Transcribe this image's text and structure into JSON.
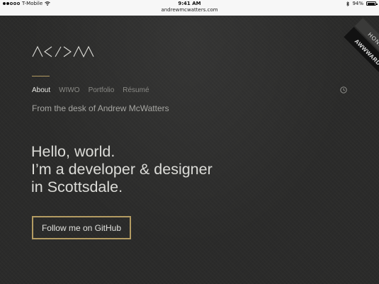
{
  "status_bar": {
    "carrier": "T-Mobile",
    "time": "9:41 AM",
    "url": "andrewmcwatters.com",
    "battery": "94%",
    "battery_level": 0.94
  },
  "header": {
    "logo_text": "/\\</>/\\/\\"
  },
  "nav": {
    "items": [
      {
        "label": "About"
      },
      {
        "label": "WIWO"
      },
      {
        "label": "Portfolio"
      },
      {
        "label": "Résumé"
      }
    ]
  },
  "tagline": "From the desk of Andrew McWatters",
  "hero": {
    "line1": "Hello, world.",
    "line2": "I’m a developer & designer",
    "line3": "in Scottsdale."
  },
  "cta": {
    "label": "Follow me on GitHub"
  },
  "ribbon": {
    "top": "HONORS",
    "bottom": "AWWWARDS"
  },
  "colors": {
    "accent": "#b39b62",
    "background": "#2b2b2a"
  }
}
